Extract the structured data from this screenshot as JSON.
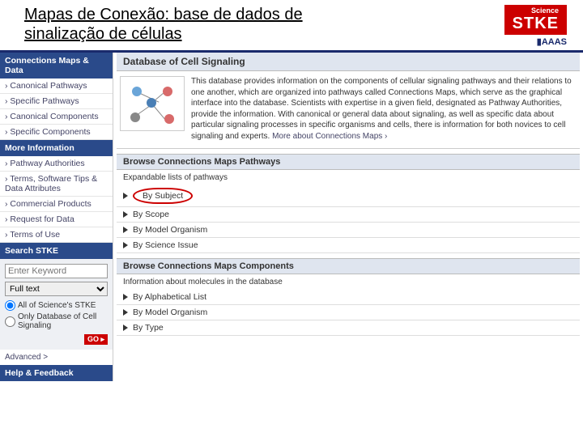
{
  "header": {
    "title": "Mapas de Conexão: base de dados de sinalização de células",
    "logo_sci": "Science",
    "logo_main": "STKE",
    "logo_aaas": "▮AAAS"
  },
  "sidebar": {
    "heads": [
      "Connections Maps & Data",
      "More Information",
      "Search STKE",
      "Help & Feedback"
    ],
    "group1": [
      "Canonical Pathways",
      "Specific Pathways",
      "Canonical Components",
      "Specific Components"
    ],
    "group2": [
      "Pathway Authorities",
      "Terms, Software Tips & Data Attributes",
      "Commercial Products",
      "Request for Data",
      "Terms of Use"
    ],
    "search": {
      "placeholder": "Enter Keyword",
      "select": "Full text",
      "radio1": "All of Science's STKE",
      "radio2": "Only Database of Cell Signaling",
      "go": "GO ▸",
      "advanced": "Advanced >"
    }
  },
  "main": {
    "title": "Database of Cell Signaling",
    "desc": "This database provides information on the components of cellular signaling pathways and their relations to one another, which are organized into pathways called Connections Maps, which serve as the graphical interface into the database. Scientists with expertise in a given field, designated as Pathway Authorities, provide the information. With canonical or general data about signaling, as well as specific data about particular signaling processes in specific organisms and cells, there is information for both novices to cell signaling and experts. ",
    "more": "More about Connections Maps ›",
    "pathways": {
      "head": "Browse Connections Maps Pathways",
      "sub": "Expandable lists of pathways",
      "items": [
        "By Subject",
        "By Scope",
        "By Model Organism",
        "By Science Issue"
      ]
    },
    "components": {
      "head": "Browse Connections Maps Components",
      "sub": "Information about molecules in the database",
      "items": [
        "By Alphabetical List",
        "By Model Organism",
        "By Type"
      ]
    }
  }
}
